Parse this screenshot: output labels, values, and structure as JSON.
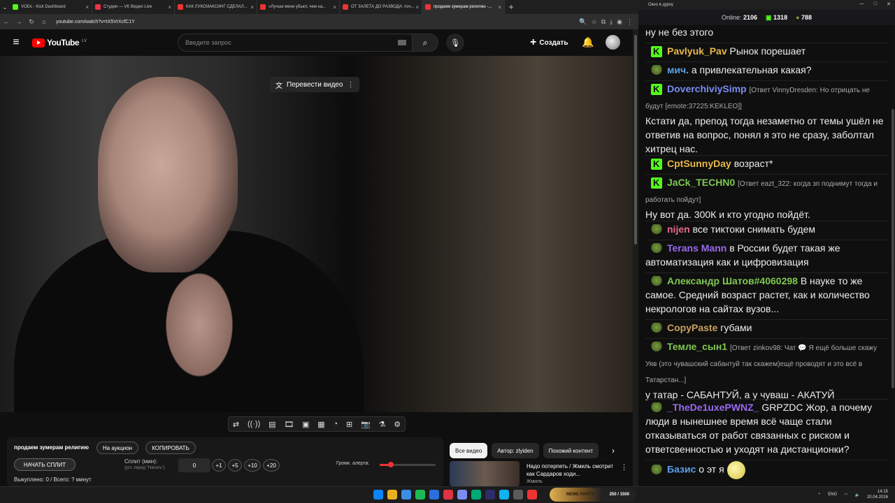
{
  "browser": {
    "tabs": [
      {
        "label": "VODs - Kick Dashboard",
        "color": "#53fc18",
        "active": false
      },
      {
        "label": "Студия — VK Видео Live",
        "color": "#e34",
        "active": false
      },
      {
        "label": "КАК ЛУКСМАКСИНГ СДЕЛАЛ...",
        "color": "#e33",
        "active": false
      },
      {
        "label": "«Лучше меня убьют, чем на...",
        "color": "#e33",
        "active": false
      },
      {
        "label": "ОТ ЗАЛЕТА ДО РАЗВОДА: поч...",
        "color": "#e33",
        "active": false
      },
      {
        "label": "продаем зумерам религию -...",
        "color": "#e33",
        "active": true
      }
    ],
    "url": "youtube.com/watch?v=tX5VrXcfC1Y"
  },
  "youtube": {
    "logo_text": "YouTube",
    "region": "LV",
    "search_placeholder": "Введите запрос",
    "create_label": "Создать",
    "translate_label": "Перевести видео"
  },
  "controls": {
    "title": "продаем зумерам религию",
    "auction_label": "На аукцион",
    "copy_label": "КОПИРОВАТЬ",
    "start_split_label": "НАЧАТЬ СПЛИТ",
    "split_label": "Сплит (мин):",
    "split_sub": "(уст. перед \"Начать\")",
    "split_value": "0",
    "increments": [
      "+1",
      "+5",
      "+10",
      "+20"
    ],
    "alert_volume_label": "Громк. алерта:",
    "alert_volume": 0.2,
    "purchased": "Выкуплено: 0 / Всего: ? минут"
  },
  "chips": [
    {
      "label": "Все видео",
      "active": true
    },
    {
      "label": "Автор: zlyiden",
      "active": false
    },
    {
      "label": "Похожий контент",
      "active": false
    }
  ],
  "recommendation": {
    "title": "Надо потерпеть / Жмиль смотрит как Сардаров ходи...",
    "channel": "Жмиль"
  },
  "chat_window": {
    "title": "Окно в дурку",
    "online_label": "Online:",
    "online_value": "2106",
    "kick_count": "1318",
    "other_count": "788"
  },
  "chat": [
    {
      "icon": "none",
      "user": "",
      "color": "#eee",
      "reply": "",
      "text": "ну не без этого"
    },
    {
      "icon": "kick",
      "user": "Pavlyuk_Pav",
      "color": "#e8b84a",
      "reply": "",
      "text": "Рынок порешает"
    },
    {
      "icon": "pepe",
      "user": "мич.",
      "color": "#5aa0e8",
      "reply": "",
      "text": "а привлекательная какая?"
    },
    {
      "icon": "kick",
      "user": "DoverchiviySimp",
      "color": "#7a8cf0",
      "reply": "[Ответ VinnyDresden: Но отрицать не будут [emote:37225:KEKLEO]]",
      "text": "Кстати да, препод тогда незаметно от темы ушёл не ответив на вопрос, понял я это не сразу, заболтал хитрец нас."
    },
    {
      "icon": "kick",
      "user": "CptSunnyDay",
      "color": "#e8b84a",
      "reply": "",
      "text": "возраст*"
    },
    {
      "icon": "kick",
      "user": "JaCk_TECHN0",
      "color": "#7ec850",
      "reply": "[Ответ eazt_322: когда зп поднимут тогда и работать пойдут]",
      "text": "Ну вот да. 300К и кто угодно пойдёт."
    },
    {
      "icon": "pepe",
      "user": "nijen",
      "color": "#e86a8a",
      "reply": "",
      "text": "все тиктоки снимать будем"
    },
    {
      "icon": "pepe",
      "user": "Terans Mann",
      "color": "#9a6af0",
      "reply": "",
      "text": "в России будет такая же автоматизация как и цифровизация"
    },
    {
      "icon": "pepe",
      "user": "Александр Шатов#4060298",
      "color": "#7ec850",
      "reply": "",
      "text": "В науке то же самое. Средний возраст растет, как и количество некрологов на сайтах вузов..."
    },
    {
      "icon": "pepe",
      "user": "CopyPaste",
      "color": "#c8a060",
      "reply": "",
      "text": "губами"
    },
    {
      "icon": "pepe",
      "user": "Темле_сын1",
      "color": "#7ec850",
      "reply": "[Ответ zinkov98: Чат 💬 Я ещё больше скажу Уяв (это чувашский сабантуй так скажем)ещё проводят и это всё в Татарстан...]",
      "text": "у татар - САБАНТУЙ, а у чуваш - АКАТУЙ"
    },
    {
      "icon": "pepe",
      "user": "_TheDe1uxePWNZ_",
      "color": "#9a6af0",
      "reply": "",
      "text": "GRPZDC Жор, а почему люди в нынешнее время всё чаще стали отказываться от работ связанных с риском и ответсвенностью и уходят на дистанционки?"
    },
    {
      "icon": "pepe",
      "user": "Базис",
      "color": "#5aa0e8",
      "reply": "",
      "text": "о эт я"
    }
  ],
  "taskbar": {
    "sticker_label": "MEME PARTY",
    "sticker_points": "250 / 1500",
    "lang": "ENG",
    "time": "14:15",
    "date": "20.04.2026"
  }
}
